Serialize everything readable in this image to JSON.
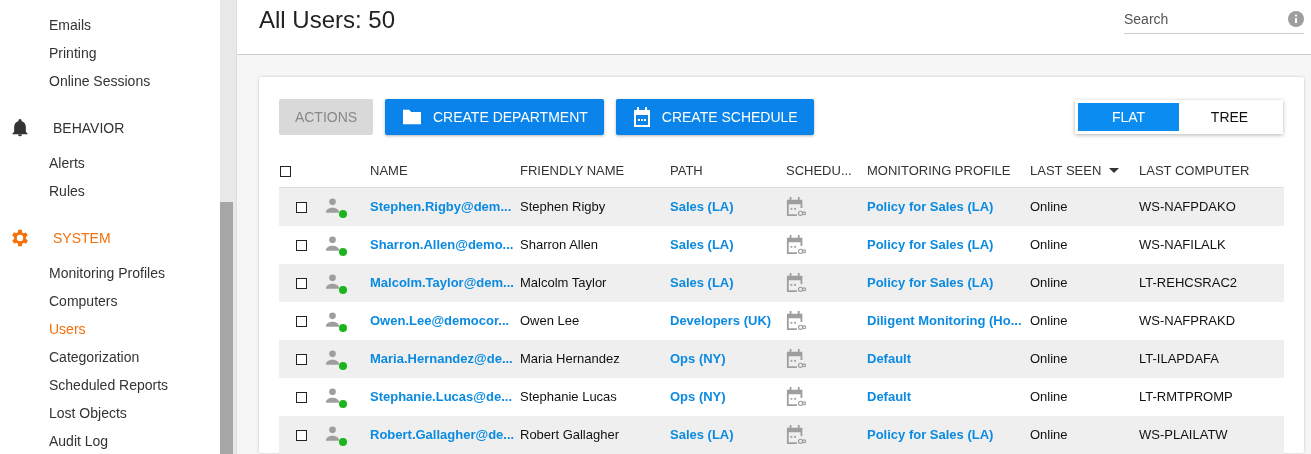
{
  "sidebar": {
    "items": [
      {
        "kind": "link",
        "label": "Emails",
        "selected": false
      },
      {
        "kind": "link",
        "label": "Printing",
        "selected": false
      },
      {
        "kind": "link",
        "label": "Online Sessions",
        "selected": false
      },
      {
        "kind": "section",
        "label": "BEHAVIOR",
        "selected": false
      },
      {
        "kind": "link",
        "label": "Alerts",
        "selected": false
      },
      {
        "kind": "link",
        "label": "Rules",
        "selected": false
      },
      {
        "kind": "section",
        "label": "SYSTEM",
        "selected": true
      },
      {
        "kind": "link",
        "label": "Monitoring Profiles",
        "selected": false
      },
      {
        "kind": "link",
        "label": "Computers",
        "selected": false
      },
      {
        "kind": "link",
        "label": "Users",
        "selected": true
      },
      {
        "kind": "link",
        "label": "Categorization",
        "selected": false
      },
      {
        "kind": "link",
        "label": "Scheduled Reports",
        "selected": false
      },
      {
        "kind": "link",
        "label": "Lost Objects",
        "selected": false
      },
      {
        "kind": "link",
        "label": "Audit Log",
        "selected": false
      }
    ]
  },
  "header": {
    "title": "All Users: 50",
    "search": {
      "placeholder": "Search"
    }
  },
  "toolbar": {
    "buttons": [
      {
        "label": "ACTIONS",
        "disabled": true
      },
      {
        "label": "CREATE DEPARTMENT",
        "disabled": false
      },
      {
        "label": "CREATE SCHEDULE",
        "disabled": false
      }
    ],
    "view_toggle": [
      {
        "label": "FLAT",
        "selected": true
      },
      {
        "label": "TREE",
        "selected": false
      }
    ]
  },
  "table": {
    "select_all_checked": false,
    "columns": [
      {
        "label": "NAME",
        "sorted": false
      },
      {
        "label": "FRIENDLY NAME",
        "sorted": false
      },
      {
        "label": "PATH",
        "sorted": false
      },
      {
        "label": "SCHEDU...",
        "sorted": false
      },
      {
        "label": "MONITORING PROFILE",
        "sorted": false
      },
      {
        "label": "LAST SEEN",
        "sorted": true
      },
      {
        "label": "LAST COMPUTER",
        "sorted": false
      }
    ],
    "rows": [
      {
        "checked": false,
        "color": "#1db31d",
        "name": "Stephen.Rigby@dem...",
        "friendly_name": "Stephen Rigby",
        "path": "Sales (LA)",
        "profile": "Policy for Sales (LA)",
        "last_seen": "Online",
        "last_computer": "WS-NAFPDAKO"
      },
      {
        "checked": false,
        "color": "#1db31d",
        "name": "Sharron.Allen@demo...",
        "friendly_name": "Sharron Allen",
        "path": "Sales (LA)",
        "profile": "Policy for Sales (LA)",
        "last_seen": "Online",
        "last_computer": "WS-NAFILALK"
      },
      {
        "checked": false,
        "color": "#1db31d",
        "name": "Malcolm.Taylor@dem...",
        "friendly_name": "Malcolm Taylor",
        "path": "Sales (LA)",
        "profile": "Policy for Sales (LA)",
        "last_seen": "Online",
        "last_computer": "LT-REHCSRAC2"
      },
      {
        "checked": false,
        "color": "#1db31d",
        "name": "Owen.Lee@democor...",
        "friendly_name": "Owen Lee",
        "path": "Developers (UK)",
        "profile": "Diligent Monitoring (Ho...",
        "last_seen": "Online",
        "last_computer": "WS-NAFPRAKD"
      },
      {
        "checked": false,
        "color": "#1db31d",
        "name": "Maria.Hernandez@de...",
        "friendly_name": "Maria Hernandez",
        "path": "Ops (NY)",
        "profile": "Default",
        "last_seen": "Online",
        "last_computer": "LT-ILAPDAFA"
      },
      {
        "checked": false,
        "color": "#1db31d",
        "name": "Stephanie.Lucas@de...",
        "friendly_name": "Stephanie Lucas",
        "path": "Ops (NY)",
        "profile": "Default",
        "last_seen": "Online",
        "last_computer": "LT-RMTPROMP"
      },
      {
        "checked": false,
        "color": "#1db31d",
        "name": "Robert.Gallagher@de...",
        "friendly_name": "Robert Gallagher",
        "path": "Sales (LA)",
        "profile": "Policy for Sales (LA)",
        "last_seen": "Online",
        "last_computer": "WS-PLAILATW"
      }
    ]
  }
}
